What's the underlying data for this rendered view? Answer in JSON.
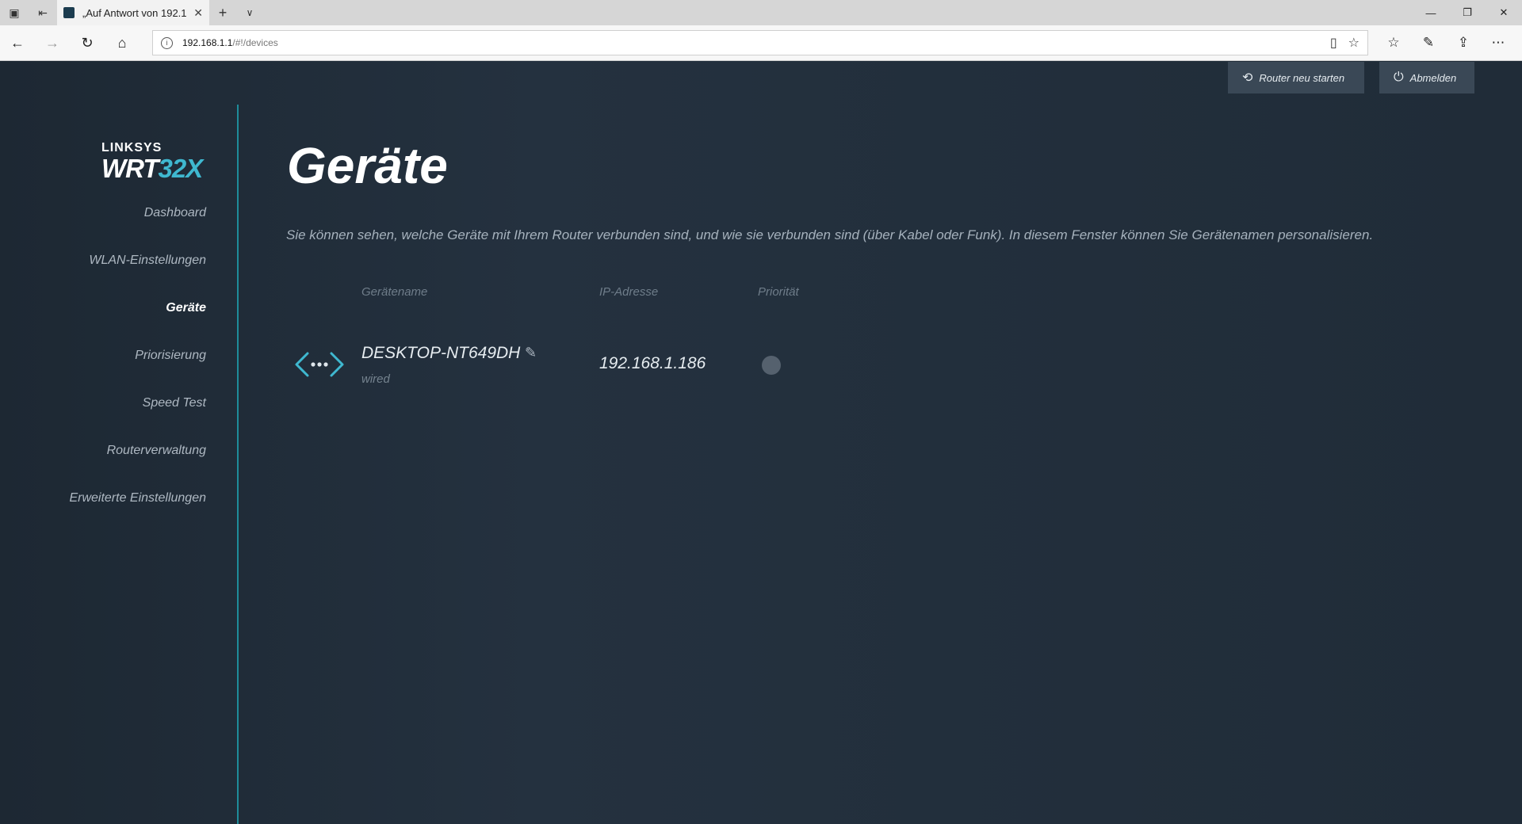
{
  "browser": {
    "tab_title": "„Auf Antwort von 192.1",
    "url_host": "192.168.1.1",
    "url_path": "/#!/devices"
  },
  "header": {
    "restart_label": "Router neu starten",
    "logout_label": "Abmelden"
  },
  "logo": {
    "brand": "LINKSYS",
    "model_prefix": "WRT",
    "model_number": "32X"
  },
  "sidebar": {
    "items": [
      {
        "label": "Dashboard"
      },
      {
        "label": "WLAN-Einstellungen"
      },
      {
        "label": "Geräte",
        "active": true
      },
      {
        "label": "Priorisierung"
      },
      {
        "label": "Speed Test"
      },
      {
        "label": "Routerverwaltung"
      },
      {
        "label": "Erweiterte Einstellungen"
      }
    ]
  },
  "main": {
    "title": "Geräte",
    "description": "Sie können sehen, welche Geräte mit Ihrem Router verbunden sind, und wie sie verbunden sind (über Kabel oder Funk). In diesem Fenster können Sie Gerätenamen personalisieren.",
    "columns": {
      "name": "Gerätename",
      "ip": "IP-Adresse",
      "priority": "Priorität"
    },
    "devices": [
      {
        "name": "DESKTOP-NT649DH",
        "connection": "wired",
        "ip": "192.168.1.186",
        "icon": "wired-connection-icon"
      }
    ]
  }
}
